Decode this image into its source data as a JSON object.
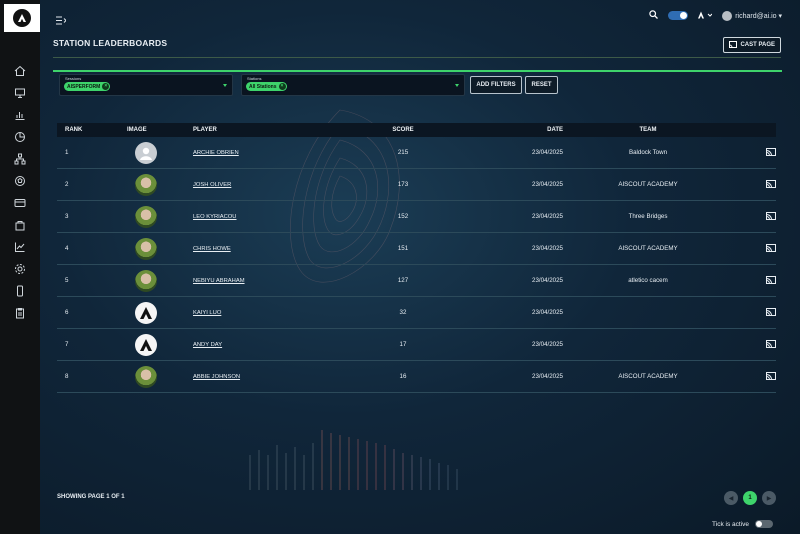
{
  "header": {
    "user_email": "richard@ai.io"
  },
  "page": {
    "title": "STATION LEADERBOARDS",
    "cast_label": "CAST PAGE"
  },
  "filters": {
    "sessions": {
      "label": "Sessions",
      "chip": "AISPERFORM"
    },
    "stations": {
      "label": "Stations",
      "chip": "All Stations"
    },
    "add_filters_label": "ADD FILTERS",
    "reset_label": "RESET"
  },
  "table": {
    "columns": [
      "RANK",
      "IMAGE",
      "PLAYER",
      "SCORE",
      "DATE",
      "TEAM"
    ],
    "rows": [
      {
        "rank": "1",
        "image": "generic-avatar",
        "player": "ARCHIE OBRIEN",
        "score": "215",
        "date": "23/04/2025",
        "team": "Baldock Town"
      },
      {
        "rank": "2",
        "image": "player-photo",
        "player": "JOSH OLIVER",
        "score": "173",
        "date": "23/04/2025",
        "team": "AISCOUT ACADEMY"
      },
      {
        "rank": "3",
        "image": "player-photo",
        "player": "LEO KYRIACOU",
        "score": "152",
        "date": "23/04/2025",
        "team": "Three Bridges"
      },
      {
        "rank": "4",
        "image": "player-photo",
        "player": "CHRIS HOWE",
        "score": "151",
        "date": "23/04/2025",
        "team": "AISCOUT ACADEMY"
      },
      {
        "rank": "5",
        "image": "player-photo",
        "player": "NEBIYU ABRAHAM",
        "score": "127",
        "date": "23/04/2025",
        "team": "atletico cacem"
      },
      {
        "rank": "6",
        "image": "brand-logo",
        "player": "KAIYI LUO",
        "score": "32",
        "date": "23/04/2025",
        "team": ""
      },
      {
        "rank": "7",
        "image": "brand-logo",
        "player": "ANDY DAY",
        "score": "17",
        "date": "23/04/2025",
        "team": ""
      },
      {
        "rank": "8",
        "image": "player-photo",
        "player": "ABBIE JOHNSON",
        "score": "16",
        "date": "23/04/2025",
        "team": "AISCOUT ACADEMY"
      }
    ]
  },
  "footer": {
    "showing": "SHOWING PAGE 1 OF 1",
    "current_page": "1",
    "tick_label": "Tick is active"
  },
  "colors": {
    "accent": "#3ed36b",
    "sidebar": "#101214",
    "background": "#10263a"
  },
  "sidebar_icons": [
    "home-icon",
    "monitor-icon",
    "bar-chart-icon",
    "pie-chart-icon",
    "hierarchy-icon",
    "ball-icon",
    "card-icon",
    "bag-icon",
    "line-chart-icon",
    "settings-icon",
    "phone-icon",
    "clipboard-icon"
  ]
}
